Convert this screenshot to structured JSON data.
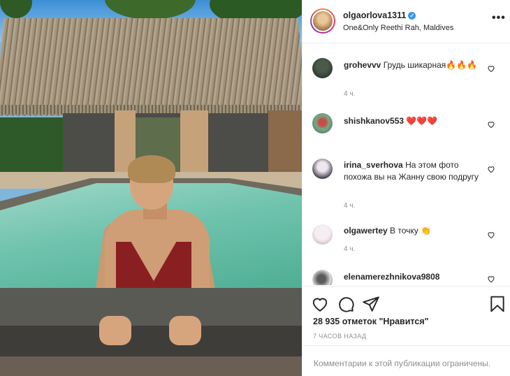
{
  "post": {
    "username": "olgaorlova1311",
    "location": "One&Only Reethi Rah, Maldives",
    "more_label": "•••"
  },
  "comments": [
    {
      "username": "grohevvv",
      "text": "Грудь шикарная🔥🔥🔥",
      "time": "4 ч."
    },
    {
      "username": "shishkanov553",
      "text": "❤️❤️❤️",
      "time": ""
    },
    {
      "username": "irina_sverhova",
      "text": "На этом фото похожа вы на Жанну свою подругу",
      "time": "4 ч."
    },
    {
      "username": "olgawertey",
      "text": "В точку 👏",
      "time": "4 ч."
    },
    {
      "username": "elenamerezhnikova9808",
      "text": "",
      "time": ""
    }
  ],
  "actions": {
    "likes": "28 935 отметок \"Нравится\"",
    "posted": "7 часов назад",
    "restricted": "Комментарии к этой публикации ограничены."
  },
  "colors": {
    "verified": "#3897f0",
    "secondary_text": "#8e8e8e",
    "primary_text": "#262626"
  },
  "icons": [
    "verified-badge-icon",
    "more-options-icon",
    "heart-icon",
    "comment-icon",
    "share-icon",
    "bookmark-icon"
  ]
}
